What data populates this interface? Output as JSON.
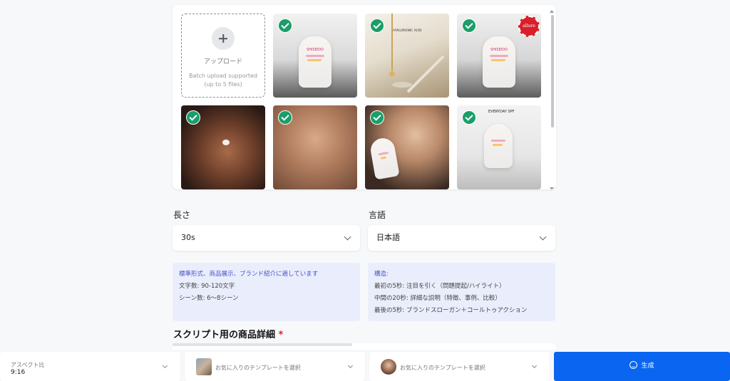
{
  "upload": {
    "label": "アップロード",
    "hint": "Batch upload supported (up to 5 files)"
  },
  "thumbnails": [
    {
      "name": "sunscreen-bottle-gradient",
      "selected": true
    },
    {
      "name": "dropper-serum",
      "selected": true,
      "caption": "HYALURONIC ACID"
    },
    {
      "name": "sunscreen-bottle-allure",
      "selected": true,
      "badge": "allure"
    },
    {
      "name": "woman-applying-cream",
      "selected": true
    },
    {
      "name": "man-touching-face",
      "selected": true
    },
    {
      "name": "woman-holding-bottle",
      "selected": true
    },
    {
      "name": "everyday-spf-infographic",
      "selected": true,
      "caption": "EVERYDAY SPF"
    }
  ],
  "length": {
    "label": "長さ",
    "value": "30s"
  },
  "language": {
    "label": "言語",
    "value": "日本語"
  },
  "info_left": {
    "line1": "標準形式、商品展示、ブランド紹介に適しています",
    "line2": "文字数: 90-120文字",
    "line3": "シーン数: 6〜8シーン"
  },
  "info_right": {
    "heading": "構造:",
    "line1": "最初の5秒: 注目を引く（問題提起/ハイライト）",
    "line2": "中間の20秒: 詳細な説明（特徴、事例、比較）",
    "line3": "最後の5秒: ブランドスローガン＋コールトゥアクション"
  },
  "product_details": {
    "title": "スクリプト用の商品詳細",
    "required_mark": "*"
  },
  "bottom_bar": {
    "aspect_label": "アスペクト比",
    "aspect_value": "9:16",
    "template1_placeholder": "お気に入りのテンプレートを選択",
    "template2_placeholder": "お気に入りのテンプレートを選択",
    "generate_label": "生成"
  },
  "colors": {
    "accent": "#0a66f0",
    "check": "#1a9e6a",
    "info_bg": "#eaeefc",
    "required": "#e02424"
  }
}
